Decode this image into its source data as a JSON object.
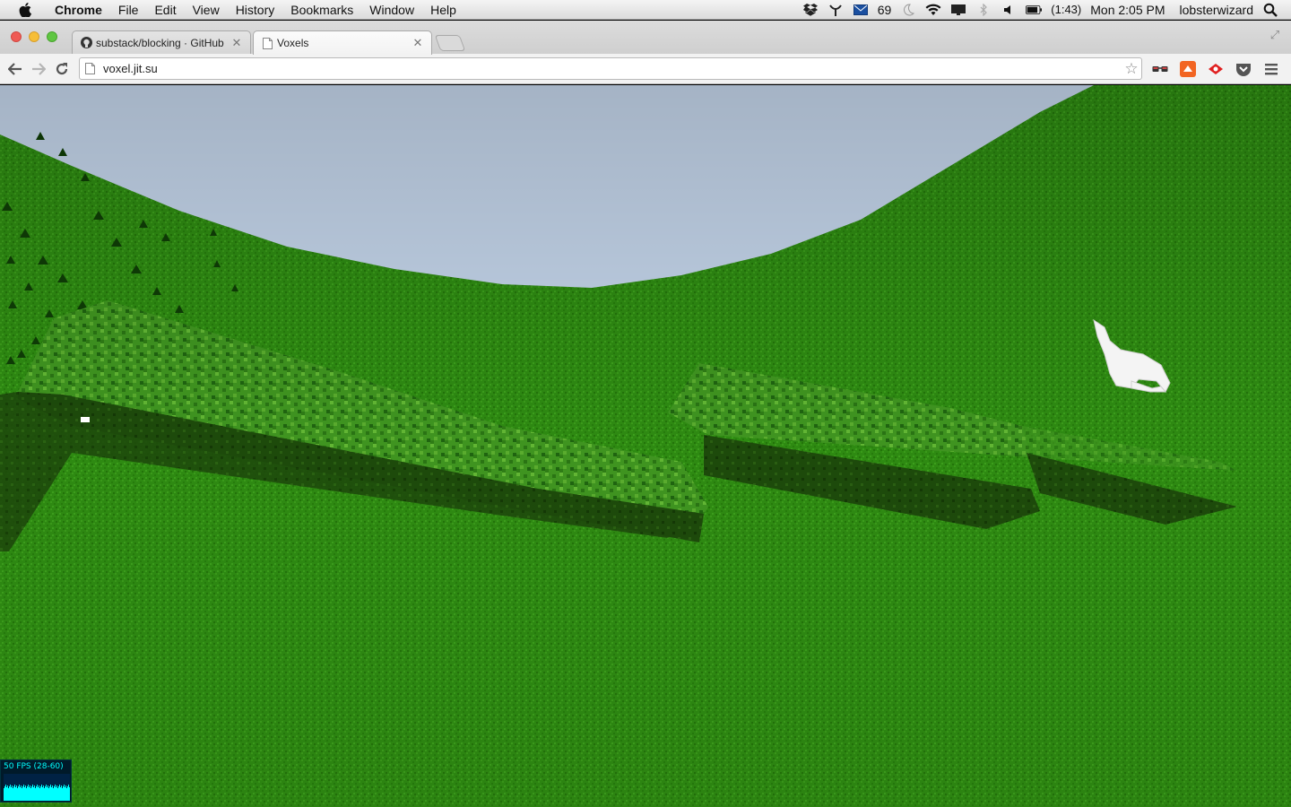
{
  "menubar": {
    "app_name": "Chrome",
    "menus": [
      "File",
      "Edit",
      "View",
      "History",
      "Bookmarks",
      "Window",
      "Help"
    ],
    "mail_count": "69",
    "battery": "(1:43)",
    "clock": "Mon 2:05 PM",
    "user": "lobsterwizard"
  },
  "tabs": [
    {
      "title": "substack/blocking · GitHub",
      "active": false
    },
    {
      "title": "Voxels",
      "active": true
    }
  ],
  "toolbar": {
    "url": "voxel.jit.su"
  },
  "game": {
    "fps_label": "50 FPS (28-60)",
    "sky_color": "#c2d3e8",
    "grass_color": "#2e8a12",
    "leaf_color": "#4aa126",
    "shadow_color": "#1d4a0b",
    "creature_color": "#f4f4f4"
  }
}
